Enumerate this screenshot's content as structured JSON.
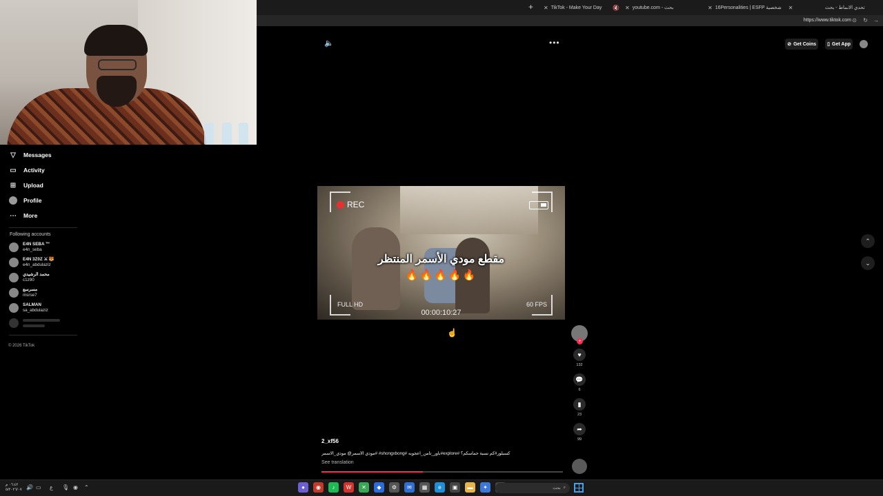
{
  "browser": {
    "tabs": [
      {
        "label": "TikTok - Make Your Day"
      },
      {
        "label": "youtube.com - بحث"
      },
      {
        "label": "16Personalities | ESFP شخصية"
      },
      {
        "label": "تحدي الانماط - بحث"
      }
    ],
    "url": "https://www.tiktok.com"
  },
  "sidebar": {
    "nav": [
      {
        "label": "Messages",
        "icon": "send-icon"
      },
      {
        "label": "Activity",
        "icon": "inbox-icon"
      },
      {
        "label": "Upload",
        "icon": "upload-icon"
      },
      {
        "label": "Profile",
        "icon": "profile-avatar"
      },
      {
        "label": "More",
        "icon": "more-dots-icon"
      }
    ],
    "following_title": "Following accounts",
    "accounts": [
      {
        "name": "E4N SEBA ™",
        "handle": "e4n_seba"
      },
      {
        "name": "E4N 3Z0Z ⚔ 🐯",
        "handle": "e4n_abdulaziz"
      },
      {
        "name": "محمد الرشيدي",
        "handle": "c1z90"
      },
      {
        "name": "مسرسع",
        "handle": "msrse7"
      },
      {
        "name": "SALMAN",
        "handle": "sa_abdulaziz"
      }
    ],
    "copyright": "© 2026 TikTok"
  },
  "header": {
    "get_coins": "Get Coins",
    "get_app": "Get App"
  },
  "video": {
    "rec": "REC",
    "caption": "مقطع مودي الأسمر المنتظر",
    "fires": "🔥🔥🔥🔥🔥",
    "full_hd": "FULL HD",
    "fps": "60 FPS",
    "timecode": "00:00:10:27",
    "progress": 0.42
  },
  "actions": {
    "likes": "132",
    "comments": "6",
    "saves": "23",
    "shares": "99"
  },
  "post": {
    "author": "2_xf56",
    "description": "مودي الأسمر@ مودي_الاسمر# #shongxbong# باور_تامن_اعجوبه#explore# كسبلور#كم نسبة حماسكم؟",
    "see_translation": "See translation"
  },
  "taskbar": {
    "time": "٠٦:٤٢ م",
    "date": "٥/٢٠٢٦/٠٧",
    "lang": "ع",
    "search_placeholder": "بحث"
  },
  "colors": {
    "accent": "#fe2c55",
    "background": "#000000"
  }
}
